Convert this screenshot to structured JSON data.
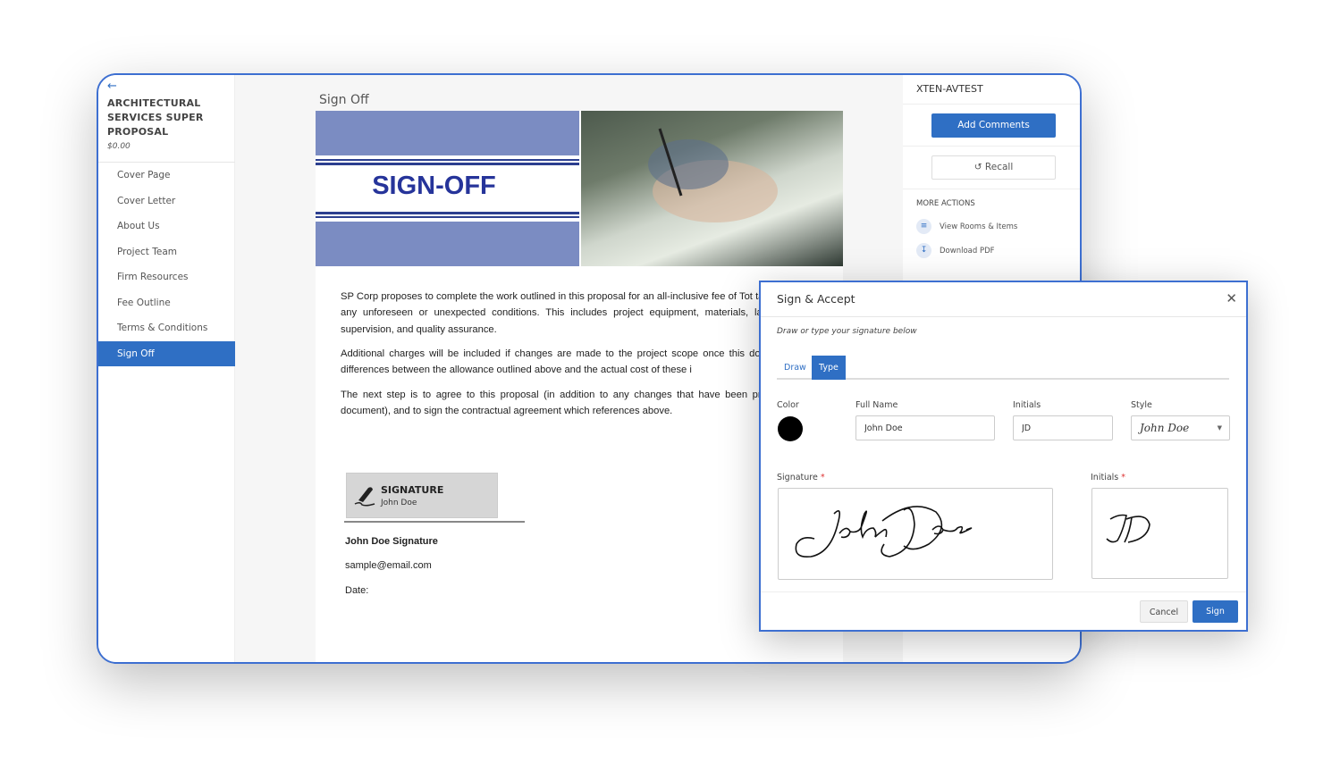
{
  "sidebar": {
    "back_icon": "arrow-left-icon",
    "title": "ARCHITECTURAL SERVICES SUPER PROPOSAL",
    "price": "$0.00",
    "items": [
      {
        "label": "Cover Page"
      },
      {
        "label": "Cover Letter"
      },
      {
        "label": "About Us"
      },
      {
        "label": "Project Team"
      },
      {
        "label": "Firm Resources"
      },
      {
        "label": "Fee Outline"
      },
      {
        "label": "Terms & Conditions"
      },
      {
        "label": "Sign Off",
        "active": true
      }
    ]
  },
  "document": {
    "section_title": "Sign Off",
    "banner_title": "SIGN-OFF",
    "paragraphs": [
      "SP Corp proposes to complete the work outlined in this proposal for an all-inclusive fee of Tot taxes, not including any unforeseen or unexpected conditions. This includes project equipment, materials, labour, scheduling, supervision, and quality assurance.",
      "Additional charges will be included if changes are made to the project scope once this docur signed and/or differences between the allowance outlined above and the actual cost of these i",
      "The next step is to agree to this proposal (in addition to any changes that have been presentation of this document), and to sign the contractual agreement which references above."
    ],
    "signature_block": {
      "label": "SIGNATURE",
      "name": "John Doe",
      "signer": "John Doe Signature",
      "email": "sample@email.com",
      "date_label": "Date:"
    }
  },
  "right_panel": {
    "account": "XTEN-AVTEST",
    "add_comments": "Add Comments",
    "recall": "Recall",
    "more_actions": "MORE ACTIONS",
    "actions": [
      {
        "label": "View Rooms & Items",
        "icon": "sliders-icon"
      },
      {
        "label": "Download PDF",
        "icon": "download-icon"
      }
    ]
  },
  "modal": {
    "title": "Sign & Accept",
    "subtitle": "Draw or type your signature below",
    "tabs": [
      {
        "label": "Draw"
      },
      {
        "label": "Type",
        "active": true
      }
    ],
    "color_label": "Color",
    "color": "#000000",
    "full_name_label": "Full Name",
    "full_name": "John Doe",
    "initials_label": "Initials",
    "initials": "JD",
    "style_label": "Style",
    "style_value": "John Doe",
    "signature_label": "Signature",
    "initials_pad_label": "Initials",
    "required_mark": "*",
    "cancel": "Cancel",
    "sign": "Sign"
  },
  "colors": {
    "accent": "#2f6fc4",
    "banner": "#7b8cc2",
    "banner_text": "#26349a"
  }
}
